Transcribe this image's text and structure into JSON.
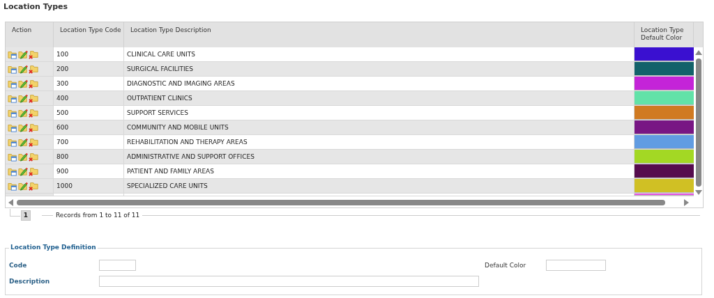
{
  "page_title": "Location Types",
  "table": {
    "columns": [
      "Action",
      "Location Type Code",
      "Location Type Description",
      "Location Type Default Color"
    ],
    "rows": [
      {
        "code": "100",
        "description": "CLINICAL CARE UNITS",
        "color": "#3a10d0"
      },
      {
        "code": "200",
        "description": "SURGICAL FACILITIES",
        "color": "#13626a"
      },
      {
        "code": "300",
        "description": "DIAGNOSTIC AND IMAGING AREAS",
        "color": "#c424d8"
      },
      {
        "code": "400",
        "description": "OUTPATIENT CLINICS",
        "color": "#62e2a8"
      },
      {
        "code": "500",
        "description": "SUPPORT SERVICES",
        "color": "#d07a22"
      },
      {
        "code": "600",
        "description": "COMMUNITY AND MOBILE UNITS",
        "color": "#781684"
      },
      {
        "code": "700",
        "description": "REHABILITATION AND THERAPY AREAS",
        "color": "#619ce2"
      },
      {
        "code": "800",
        "description": "ADMINISTRATIVE AND SUPPORT OFFICES",
        "color": "#a3d824"
      },
      {
        "code": "900",
        "description": "PATIENT AND FAMILY AREAS",
        "color": "#560c4e"
      },
      {
        "code": "1000",
        "description": "SPECIALIZED CARE UNITS",
        "color": "#d0c024"
      }
    ],
    "partial_row": {
      "color": "#e650e6"
    }
  },
  "pager": {
    "pages": [
      {
        "label": "1",
        "selected": true
      }
    ],
    "summary": "Records from 1 to 11 of 11"
  },
  "form": {
    "legend": "Location Type Definition",
    "fields": [
      {
        "label": "Code"
      },
      {
        "label": "Default Color"
      },
      {
        "label": "Description"
      }
    ]
  }
}
